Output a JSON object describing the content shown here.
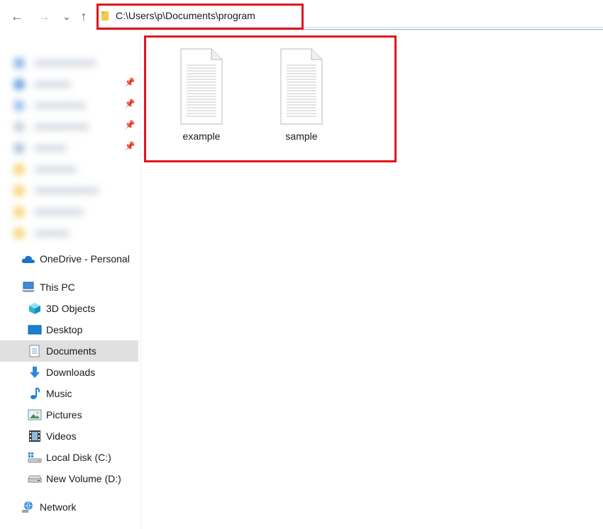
{
  "navbar": {
    "back_icon": "←",
    "forward_icon": "→",
    "recent_icon": "⌄",
    "up_icon": "↑",
    "address_path": "C:\\Users\\p\\Documents\\program"
  },
  "sidebar": {
    "pin_icon": "📌",
    "items": [
      {
        "label": "OneDrive - Personal",
        "icon": "onedrive-cloud-icon"
      },
      {
        "label": "This PC",
        "icon": "computer-icon"
      },
      {
        "label": "3D Objects",
        "icon": "3d-objects-icon"
      },
      {
        "label": "Desktop",
        "icon": "desktop-icon"
      },
      {
        "label": "Documents",
        "icon": "documents-icon",
        "selected": true
      },
      {
        "label": "Downloads",
        "icon": "download-arrow-icon"
      },
      {
        "label": "Music",
        "icon": "music-note-icon"
      },
      {
        "label": "Pictures",
        "icon": "pictures-icon"
      },
      {
        "label": "Videos",
        "icon": "film-strip-icon"
      },
      {
        "label": "Local Disk (C:)",
        "icon": "windows-drive-icon"
      },
      {
        "label": "New Volume (D:)",
        "icon": "drive-icon"
      },
      {
        "label": "Network",
        "icon": "network-icon"
      }
    ]
  },
  "files": [
    {
      "name": "example",
      "icon": "text-file-icon"
    },
    {
      "name": "sample",
      "icon": "text-file-icon"
    }
  ],
  "colors": {
    "highlight": "#e0141e",
    "selection": "#e0e0e0",
    "folder": "#f2c94c",
    "accent": "#1979ca"
  }
}
